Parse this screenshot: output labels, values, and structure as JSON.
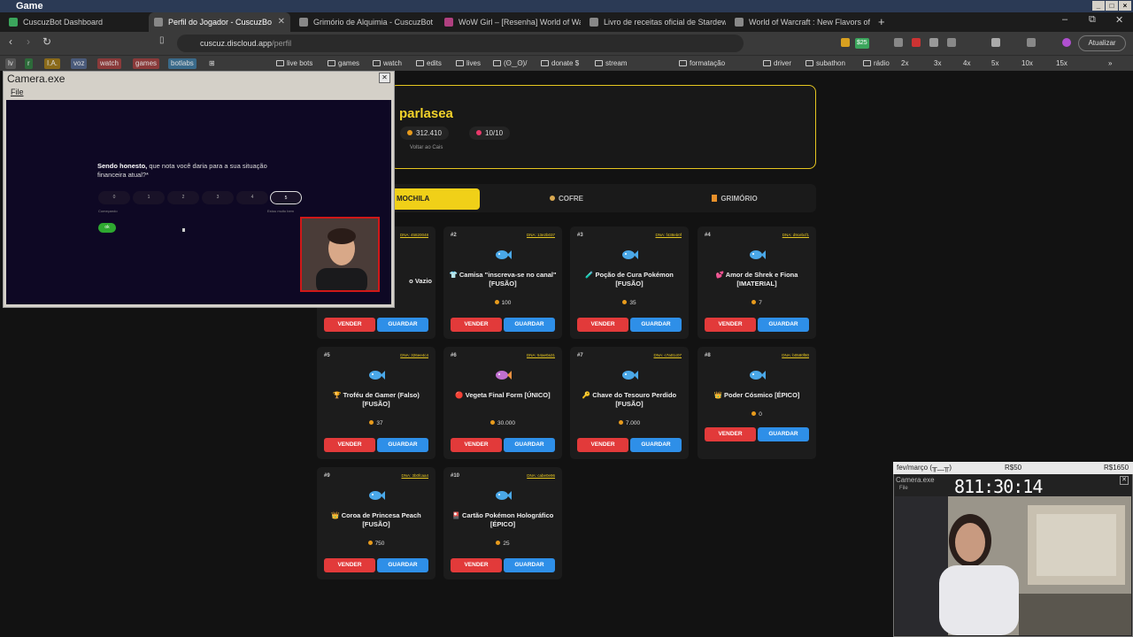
{
  "os": {
    "title": "Game"
  },
  "tabs": [
    {
      "label": "CuscuzBot Dashboard",
      "color": "#3ba55c"
    },
    {
      "label": "Perfil do Jogador - CuscuzBo",
      "color": "#888888"
    },
    {
      "label": "Grimório de Alquimia - CuscuzBot",
      "color": "#888888"
    },
    {
      "label": "WoW Girl – [Resenha] World of Warc",
      "color": "#b04080"
    },
    {
      "label": "Livro de receitas oficial de Stardew V",
      "color": "#888888"
    },
    {
      "label": "World of Warcraft : New Flavors of A",
      "color": "#888888"
    }
  ],
  "address": {
    "host": "cuscuz.discloud.app",
    "path": "/perfil"
  },
  "browser": {
    "update_label": "Atualizar",
    "badge": "$25"
  },
  "bookmarks": {
    "pills": [
      "lv",
      "r",
      "I.A.",
      "voz",
      "watch",
      "games",
      "botlabs"
    ],
    "items": [
      "live bots",
      "games",
      "watch",
      "edits",
      "lives",
      "(ʘ‿ʘ)/",
      "donate $",
      "stream",
      "formatação",
      "driver",
      "subathon",
      "rádio",
      "2x",
      "3x",
      "4x",
      "5x",
      "10x",
      "15x"
    ]
  },
  "profile": {
    "name": "parlasea",
    "coins": "312.410",
    "hearts": "10/10",
    "back": "Voltar ao Cais"
  },
  "profile_tabs": [
    "MOCHILA",
    "COFRE",
    "GRIMÓRIO"
  ],
  "buttons": {
    "sell": "VENDER",
    "store": "GUARDAR"
  },
  "items": [
    {
      "num": "#1",
      "dna": "DNA: 45820048",
      "name": "o Vazio",
      "price": ""
    },
    {
      "num": "#2",
      "dna": "DNA: 13e2b037",
      "name": "👕 Camisa \"inscreva-se no canal\" [FUSÃO]",
      "price": "100"
    },
    {
      "num": "#3",
      "dna": "DNA: f438eb0f",
      "name": "🧪 Poção de Cura Pokémon [FUSÃO]",
      "price": "35"
    },
    {
      "num": "#4",
      "dna": "DNA: d9cebcf1",
      "name": "💕 Amor de Shrek e Fiona [IMATERIAL]",
      "price": "7"
    },
    {
      "num": "#5",
      "dna": "DNA: 326ee4c4",
      "name": "🏆 Troféu de Gamer (Falso) [FUSÃO]",
      "price": "37"
    },
    {
      "num": "#6",
      "dna": "DNA: 54ae0a31",
      "name": "🔴 Vegeta Final Form [ÚNICO]",
      "price": "30.000"
    },
    {
      "num": "#7",
      "dna": "DNA: c7a01c07",
      "name": "🔑 Chave do Tesouro Perdido [FUSÃO]",
      "price": "7.000"
    },
    {
      "num": "#8",
      "dna": "DNA: b0580f80",
      "name": "👑 Poder Cósmico [ÉPICO]",
      "price": "0"
    },
    {
      "num": "#9",
      "dna": "DNA: 3b0fcaa4",
      "name": "👑 Coroa de Princesa Peach [FUSÃO]",
      "price": "750"
    },
    {
      "num": "#10",
      "dna": "DNA: cabe0e96",
      "name": "🎴 Cartão Pokémon Holográfico [ÉPICO]",
      "price": "25"
    }
  ],
  "camera1": {
    "title": "Camera.exe",
    "menu": "File",
    "question_bold": "Sendo honesto,",
    "question_rest": " que nota você daria para a sua situação financeira atual?*",
    "ratings": [
      "0",
      "1",
      "2",
      "3",
      "4",
      "5"
    ],
    "low_label": "Começando",
    "high_label": "Estou muito bem",
    "ok": "ok"
  },
  "camera2": {
    "goal_left": "fev/março (╥﹏╥)",
    "goal_mid": "R$50",
    "goal_right": "R$1650",
    "title": "Camera.exe",
    "menu": "File",
    "timer": "811:30:14"
  }
}
